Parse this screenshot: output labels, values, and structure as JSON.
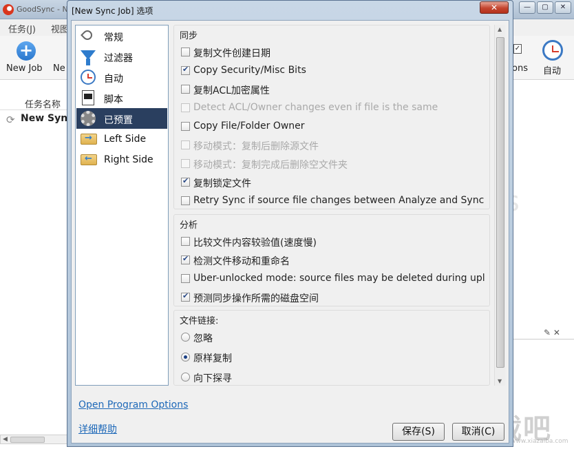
{
  "main_window": {
    "title": "GoodSync - N",
    "menu": [
      "任务(J)",
      "视图"
    ],
    "toolbar": {
      "new_job_label": "New Job",
      "ne_label": "Ne",
      "options_label": "ons",
      "auto_label": "自动"
    },
    "job_list": {
      "header": "任务名称",
      "row_label": "New Syn"
    },
    "bg_letter": "s",
    "watermark": "下载吧",
    "watermark_url": "www.xiazaiba.com"
  },
  "dialog": {
    "title": "[New Sync Job] 选项",
    "close_label": "✕",
    "nav": [
      {
        "label": "常规",
        "icon": "wrench-checklist-icon"
      },
      {
        "label": "过滤器",
        "icon": "funnel-icon"
      },
      {
        "label": "自动",
        "icon": "clock-icon"
      },
      {
        "label": "脚本",
        "icon": "script-icon"
      },
      {
        "label": "已预置",
        "icon": "gear-icon",
        "selected": true
      },
      {
        "label": "Left Side",
        "icon": "folder-right-arrow-icon"
      },
      {
        "label": "Right Side",
        "icon": "folder-left-arrow-icon"
      }
    ],
    "groups": {
      "sync": {
        "title": "同步",
        "items": [
          {
            "label": "复制文件创建日期",
            "checked": false,
            "disabled": false
          },
          {
            "label": "Copy Security/Misc Bits",
            "checked": true,
            "disabled": false
          },
          {
            "label": "复制ACL加密属性",
            "checked": false,
            "disabled": false
          },
          {
            "label": "Detect ACL/Owner changes even if file is the same",
            "checked": false,
            "disabled": true
          },
          {
            "label": "Copy File/Folder Owner",
            "checked": false,
            "disabled": false
          },
          {
            "label": "移动模式：复制后删除源文件",
            "checked": false,
            "disabled": true
          },
          {
            "label": "移动模式：复制完成后删除空文件夹",
            "checked": false,
            "disabled": true
          },
          {
            "label": "复制锁定文件",
            "checked": true,
            "disabled": false
          },
          {
            "label": "Retry Sync if source file changes between Analyze and Sync",
            "checked": false,
            "disabled": false
          }
        ]
      },
      "analyze": {
        "title": "分析",
        "items": [
          {
            "label": "比较文件内容较验值(速度慢)",
            "checked": false
          },
          {
            "label": "检测文件移动和重命名",
            "checked": true
          },
          {
            "label": "Uber-unlocked mode: source files may be deleted during upl",
            "checked": false
          },
          {
            "label": "预测同步操作所需的磁盘空间",
            "checked": true
          }
        ]
      },
      "links": {
        "title": "文件链接:",
        "options": [
          {
            "label": "忽略",
            "checked": false
          },
          {
            "label": "原样复制",
            "checked": true
          },
          {
            "label": "向下探寻",
            "checked": false
          }
        ]
      }
    },
    "open_program_options": "Open Program Options",
    "help": "详细帮助",
    "save_label": "保存(S)",
    "cancel_label": "取消(C)"
  }
}
